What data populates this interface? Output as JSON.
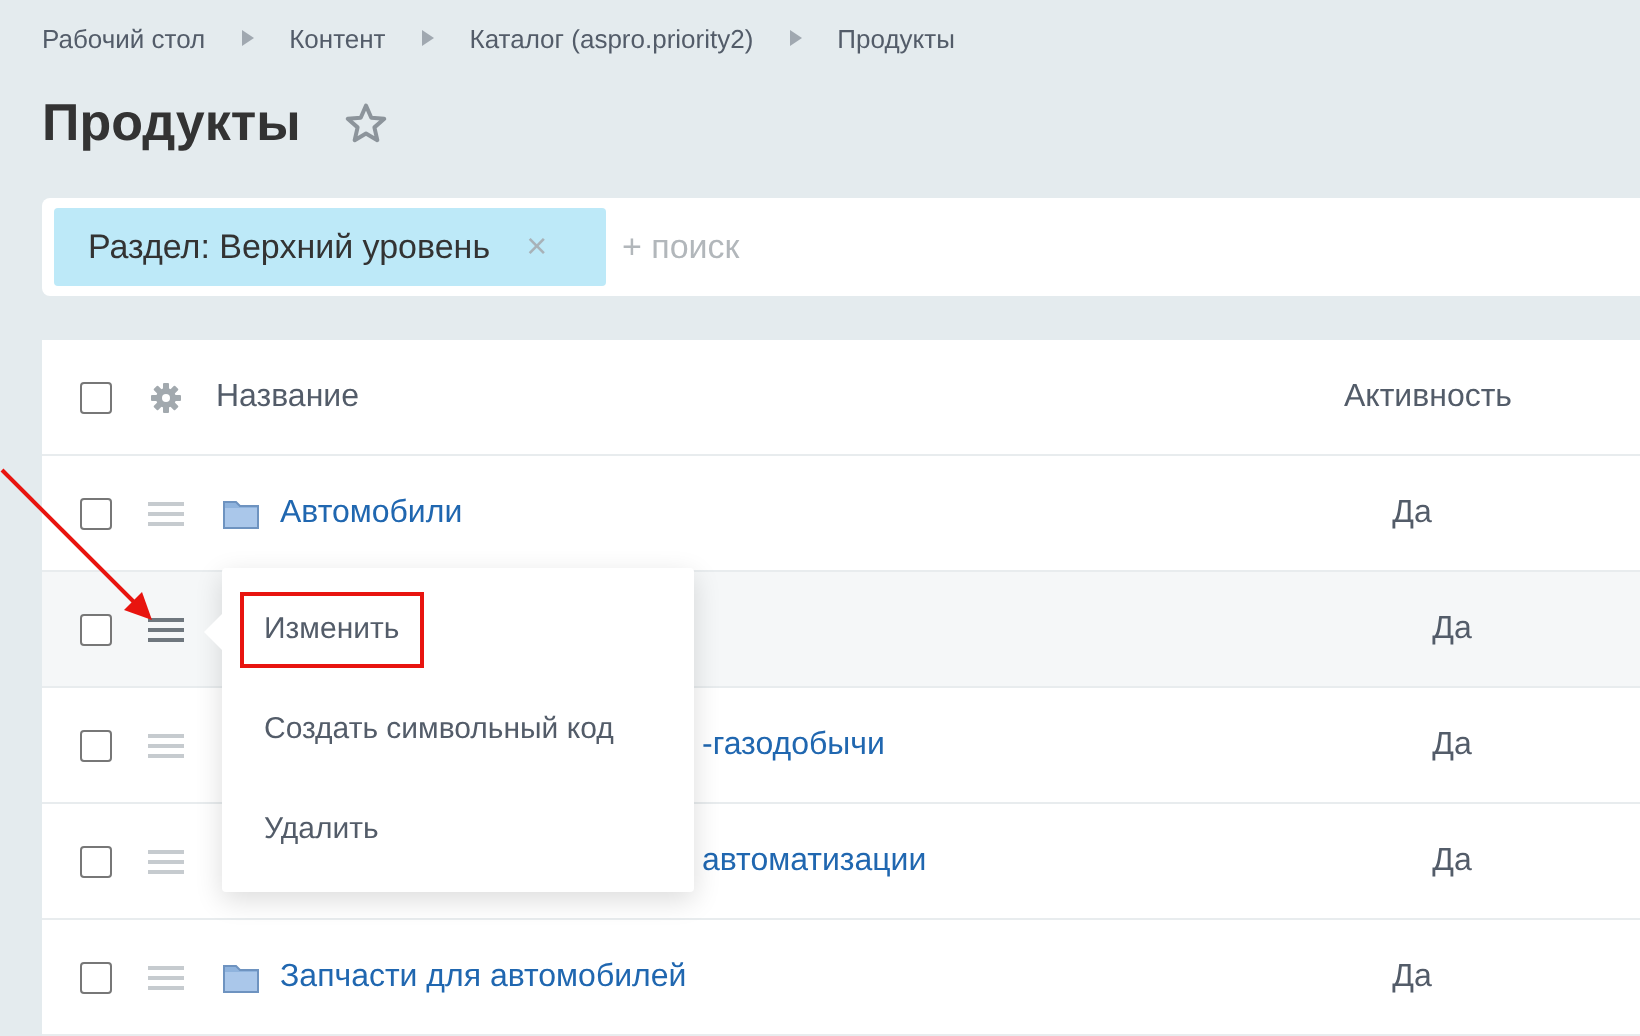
{
  "breadcrumbs": [
    "Рабочий стол",
    "Контент",
    "Каталог (aspro.priority2)",
    "Продукты"
  ],
  "title": "Продукты",
  "filter": {
    "tag": "Раздел: Верхний уровень",
    "remove": "×",
    "placeholder": "+ поиск"
  },
  "table": {
    "columns": [
      "Название",
      "Активность"
    ],
    "select_all_checked": false,
    "rows": [
      {
        "kind": "folder",
        "name": "Автомобили",
        "active": "Да",
        "checked": false,
        "hovered": false
      },
      {
        "kind": "covered",
        "name": "",
        "active": "Да",
        "checked": false,
        "hovered": true
      },
      {
        "kind": "covered",
        "name": "-газодобычи",
        "active": "Да",
        "checked": false,
        "hovered": false
      },
      {
        "kind": "covered",
        "name": "автоматизации",
        "active": "Да",
        "checked": false,
        "hovered": false
      },
      {
        "kind": "folder",
        "name": "Запчасти для автомобилей",
        "active": "Да",
        "checked": false,
        "hovered": false
      }
    ]
  },
  "context_menu": {
    "items": [
      {
        "label": "Изменить",
        "highlighted": true
      },
      {
        "label": "Создать символьный код",
        "highlighted": false
      },
      {
        "label": "Удалить",
        "highlighted": false
      }
    ]
  }
}
